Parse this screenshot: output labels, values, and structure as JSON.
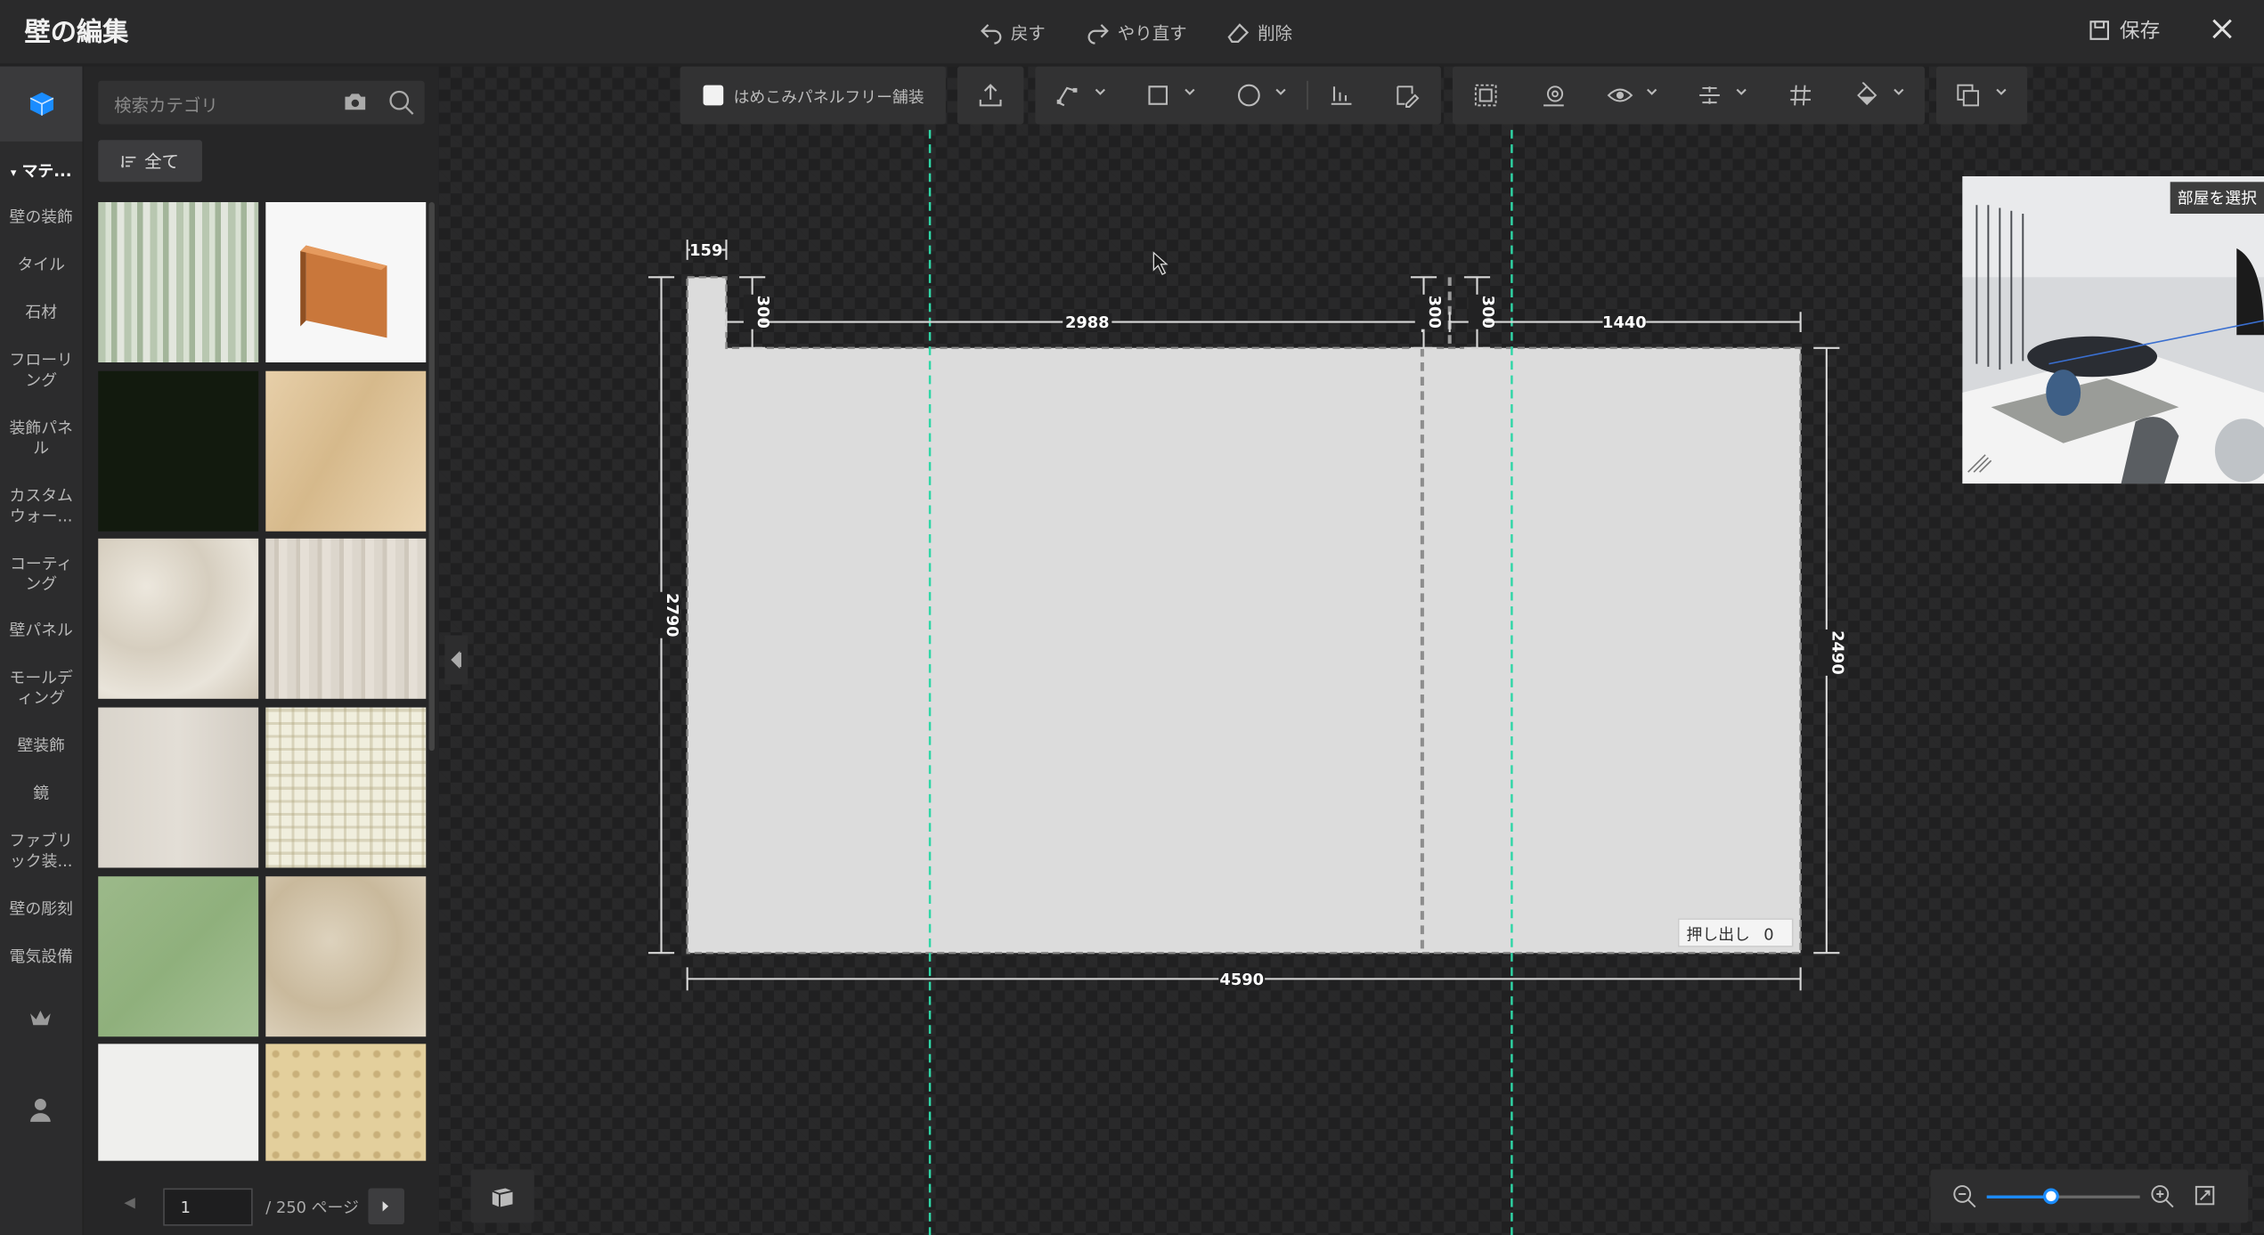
{
  "header": {
    "title": "壁の編集",
    "undo": "戻す",
    "redo": "やり直す",
    "delete": "削除",
    "save": "保存"
  },
  "sidebar": {
    "categories": [
      "マテ...",
      "壁の装飾",
      "タイル",
      "石材",
      "フローリング",
      "装飾パネル",
      "カスタムウォー...",
      "コーティング",
      "壁パネル",
      "モールディング",
      "壁装飾",
      "鏡",
      "ファブリック装...",
      "壁の彫刻",
      "電気設備"
    ]
  },
  "panel": {
    "search_placeholder": "検索カテゴリ",
    "all_label": "全て"
  },
  "pager": {
    "page": "1",
    "total": "/ 250 ページ"
  },
  "toolbar": {
    "seamless_label": "はめこみパネルフリー舗装"
  },
  "minimap": {
    "select_room": "部屋を選択"
  },
  "drawing": {
    "dims": {
      "d159": "159",
      "d300a": "300",
      "d2988": "2988",
      "d300b": "300",
      "d300c": "300",
      "d1440": "1440",
      "d2790": "2790",
      "d2490": "2490",
      "d4590": "4590"
    },
    "extrude_label": "押し出し",
    "extrude_value": "0"
  },
  "zoom": {
    "level": 0.42
  },
  "colors": {
    "accent": "#1a8cff",
    "guide": "#2fd6a6",
    "wall": "#dcdcdc"
  }
}
